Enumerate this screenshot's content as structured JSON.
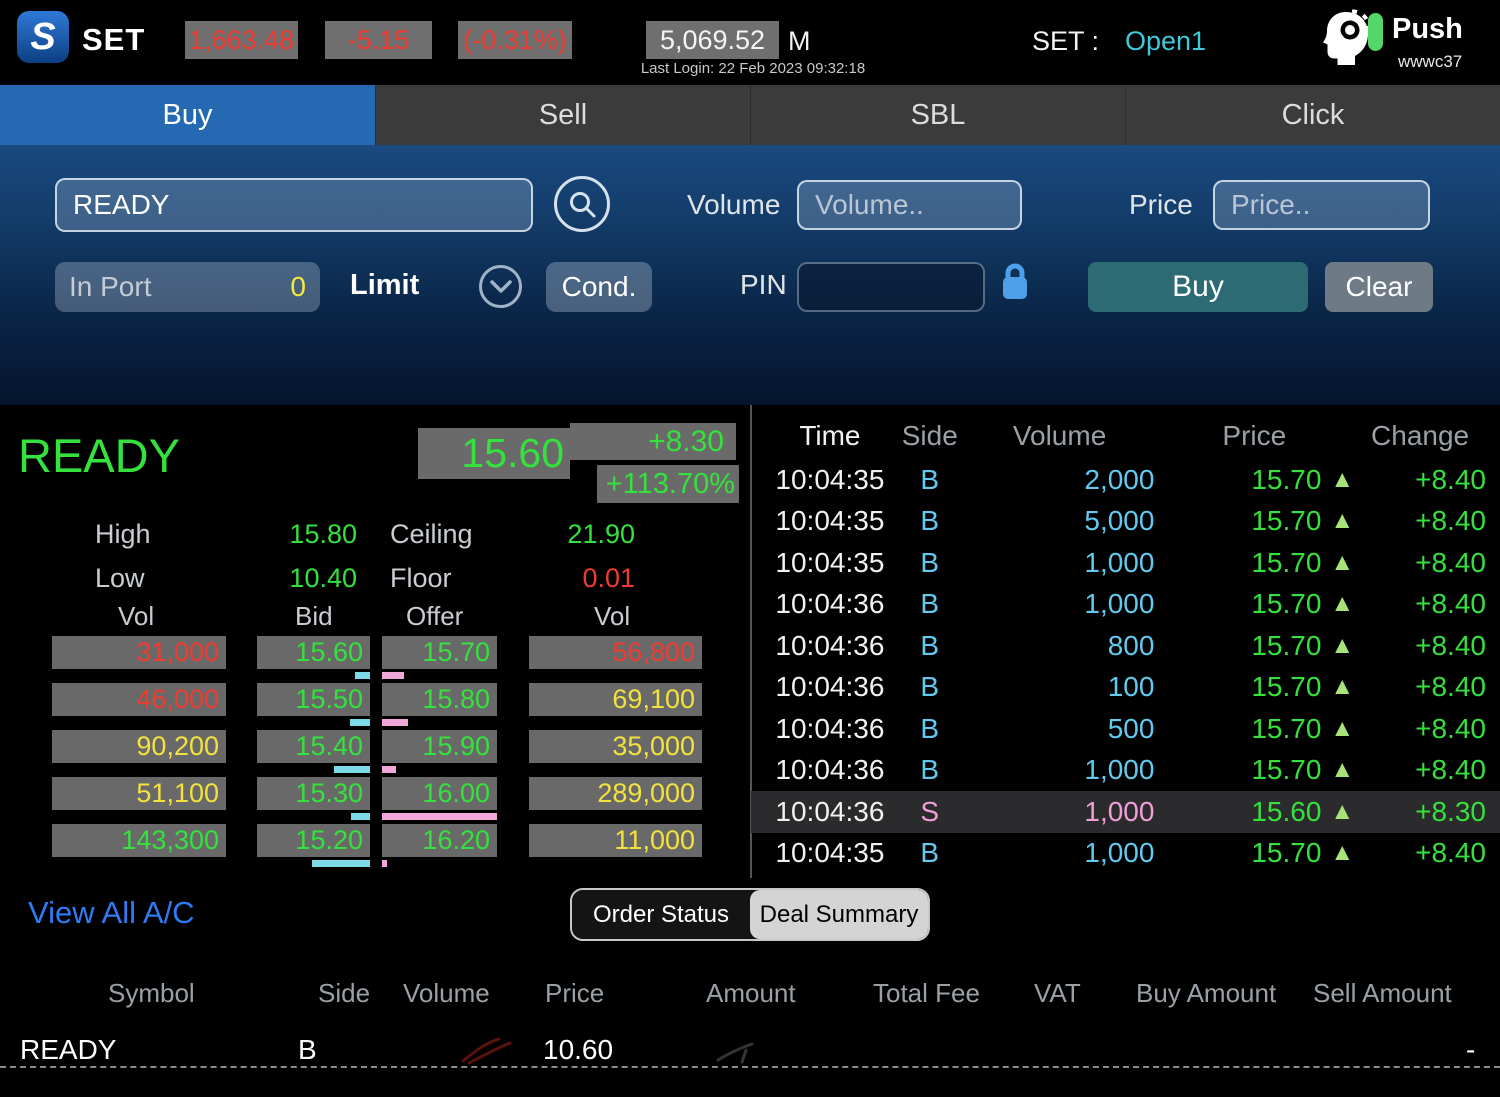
{
  "header": {
    "app_name": "SET",
    "logo_glyph": "S",
    "index_value": "1,663.48",
    "index_change": "-5.15",
    "index_change_pct": "(-0.31%)",
    "market_value": "5,069.52",
    "market_value_unit": "M",
    "last_login": "Last Login: 22 Feb 2023 09:32:18",
    "market_label": "SET :",
    "market_status": "Open1",
    "push_label": "Push",
    "username": "wwwc37"
  },
  "tabs": [
    {
      "label": "Buy"
    },
    {
      "label": "Sell"
    },
    {
      "label": "SBL"
    },
    {
      "label": "Click"
    }
  ],
  "order_form": {
    "symbol_value": "READY",
    "volume_label": "Volume",
    "volume_placeholder": "Volume..",
    "price_label": "Price",
    "price_placeholder": "Price..",
    "in_port_label": "In Port",
    "in_port_value": "0",
    "order_type": "Limit",
    "cond_label": "Cond.",
    "pin_label": "PIN",
    "buy_label": "Buy",
    "clear_label": "Clear"
  },
  "quote": {
    "symbol": "READY",
    "last_price": "15.60",
    "change": "+8.30",
    "change_pct": "+113.70%",
    "high_label": "High",
    "high": "15.80",
    "ceiling_label": "Ceiling",
    "ceiling": "21.90",
    "low_label": "Low",
    "low": "10.40",
    "floor_label": "Floor",
    "floor": "0.01"
  },
  "depth": {
    "headers": [
      "Vol",
      "Bid",
      "Offer",
      "Vol"
    ],
    "rows": [
      {
        "cells": [
          {
            "v": "31,000",
            "color": "red"
          },
          {
            "v": "15.60",
            "color": "green"
          },
          {
            "v": "15.70",
            "color": "green"
          },
          {
            "v": "56,800",
            "color": "red"
          }
        ],
        "bid_bar": "15px",
        "offer_bar": "22px"
      },
      {
        "cells": [
          {
            "v": "46,000",
            "color": "red"
          },
          {
            "v": "15.50",
            "color": "green"
          },
          {
            "v": "15.80",
            "color": "green"
          },
          {
            "v": "69,100",
            "color": "yellow"
          }
        ],
        "bid_bar": "20px",
        "offer_bar": "26px"
      },
      {
        "cells": [
          {
            "v": "90,200",
            "color": "yellow"
          },
          {
            "v": "15.40",
            "color": "green"
          },
          {
            "v": "15.90",
            "color": "green"
          },
          {
            "v": "35,000",
            "color": "yellow"
          }
        ],
        "bid_bar": "36px",
        "offer_bar": "14px"
      },
      {
        "cells": [
          {
            "v": "51,100",
            "color": "yellow"
          },
          {
            "v": "15.30",
            "color": "green"
          },
          {
            "v": "16.00",
            "color": "green"
          },
          {
            "v": "289,000",
            "color": "yellow"
          }
        ],
        "bid_bar": "19px",
        "offer_bar": "115px"
      },
      {
        "cells": [
          {
            "v": "143,300",
            "color": "green"
          },
          {
            "v": "15.20",
            "color": "green"
          },
          {
            "v": "16.20",
            "color": "green"
          },
          {
            "v": "11,000",
            "color": "yellow"
          }
        ],
        "bid_bar": "58px",
        "offer_bar": "5px"
      }
    ]
  },
  "trades": {
    "headers": [
      "Time",
      "Side",
      "Volume",
      "Price",
      "Change"
    ],
    "up_icon": "▲",
    "rows": [
      {
        "time": "10:04:35",
        "side": "B",
        "volume": "2,000",
        "price": "15.70",
        "change": "+8.40",
        "side_color": "cyan"
      },
      {
        "time": "10:04:35",
        "side": "B",
        "volume": "5,000",
        "price": "15.70",
        "change": "+8.40",
        "side_color": "cyan"
      },
      {
        "time": "10:04:35",
        "side": "B",
        "volume": "1,000",
        "price": "15.70",
        "change": "+8.40",
        "side_color": "cyan"
      },
      {
        "time": "10:04:36",
        "side": "B",
        "volume": "1,000",
        "price": "15.70",
        "change": "+8.40",
        "side_color": "cyan"
      },
      {
        "time": "10:04:36",
        "side": "B",
        "volume": "800",
        "price": "15.70",
        "change": "+8.40",
        "side_color": "cyan"
      },
      {
        "time": "10:04:36",
        "side": "B",
        "volume": "100",
        "price": "15.70",
        "change": "+8.40",
        "side_color": "cyan"
      },
      {
        "time": "10:04:36",
        "side": "B",
        "volume": "500",
        "price": "15.70",
        "change": "+8.40",
        "side_color": "cyan"
      },
      {
        "time": "10:04:36",
        "side": "B",
        "volume": "1,000",
        "price": "15.70",
        "change": "+8.40",
        "side_color": "cyan"
      },
      {
        "time": "10:04:36",
        "side": "S",
        "volume": "1,000",
        "price": "15.60",
        "change": "+8.30",
        "side_color": "pink"
      },
      {
        "time": "10:04:35",
        "side": "B",
        "volume": "1,000",
        "price": "15.70",
        "change": "+8.40",
        "side_color": "cyan"
      }
    ]
  },
  "footer": {
    "view_all": "View All A/C",
    "segments": [
      {
        "label": "Order Status"
      },
      {
        "label": "Deal Summary"
      }
    ],
    "table_headers": [
      "Symbol",
      "Side",
      "Volume",
      "Price",
      "Amount",
      "Total Fee",
      "VAT",
      "Buy Amount",
      "Sell Amount"
    ],
    "row": {
      "symbol": "READY",
      "side": "B",
      "volume": "",
      "price": "10.60",
      "amount": "",
      "total_fee": "",
      "vat": "",
      "buy_amount": "",
      "sell_amount": "-"
    }
  }
}
